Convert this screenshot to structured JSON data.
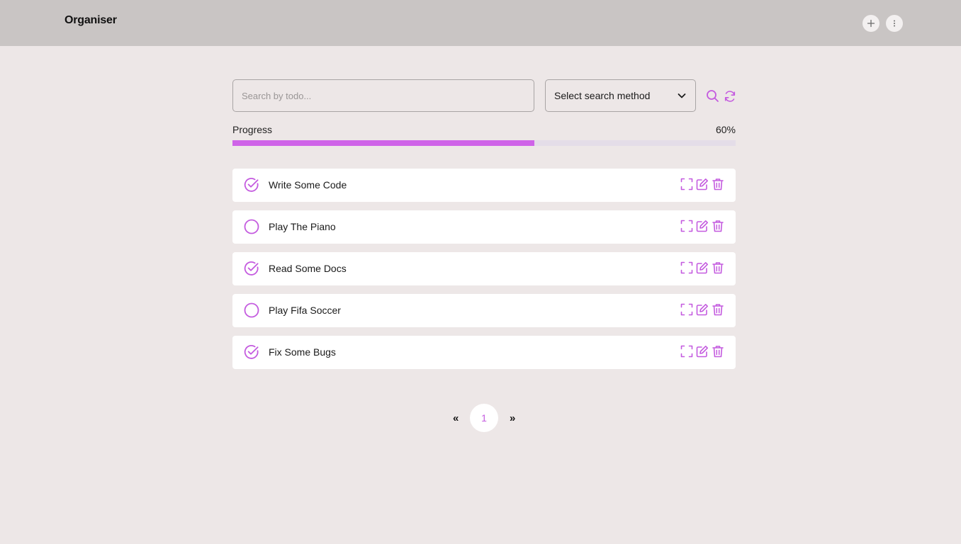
{
  "app": {
    "title": "Organiser"
  },
  "header": {
    "add_icon": "plus-icon",
    "menu_icon": "vertical-dots-icon"
  },
  "search": {
    "placeholder": "Search by todo...",
    "value": "",
    "method_label": "Select search method",
    "search_icon": "magnifier-icon",
    "refresh_icon": "refresh-icon"
  },
  "progress": {
    "label": "Progress",
    "percent_text": "60%",
    "value": 0.6
  },
  "colors": {
    "accent": "#c45bdf",
    "progress_fill": "#cf63e8",
    "progress_track": "#e4dde8",
    "topbar": "#c9c5c4",
    "background": "#ede7e7"
  },
  "todos": [
    {
      "text": "Write Some Code",
      "done": true
    },
    {
      "text": "Play The Piano",
      "done": false
    },
    {
      "text": "Read Some Docs",
      "done": true
    },
    {
      "text": "Play Fifa Soccer",
      "done": false
    },
    {
      "text": "Fix Some Bugs",
      "done": true
    }
  ],
  "todo_action_icons": [
    "expand-icon",
    "edit-icon",
    "trash-icon"
  ],
  "pagination": {
    "prev": "«",
    "current": "1",
    "next": "»"
  }
}
